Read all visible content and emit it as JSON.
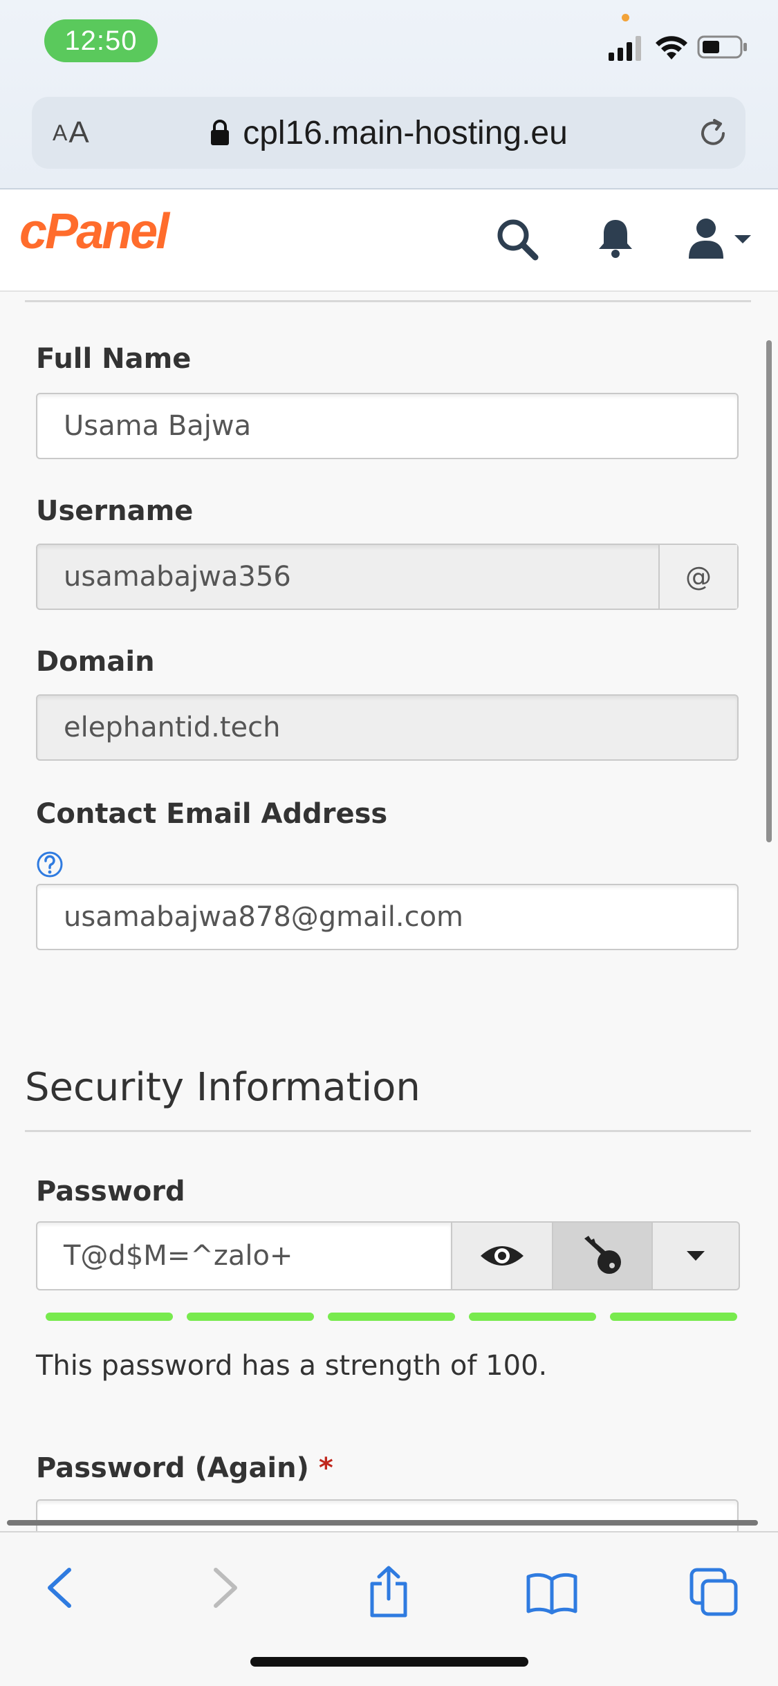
{
  "status_bar": {
    "time": "12:50"
  },
  "browser": {
    "aa_small": "A",
    "aa_large": "A",
    "url": "cpl16.main-hosting.eu"
  },
  "app": {
    "logo": "cPanel"
  },
  "form": {
    "full_name": {
      "label": "Full Name",
      "value": "Usama Bajwa"
    },
    "username": {
      "label": "Username",
      "value": "usamabajwa356",
      "addon": "@"
    },
    "domain": {
      "label": "Domain",
      "value": "elephantid.tech"
    },
    "contact_email": {
      "label": "Contact Email Address",
      "value": "usamabajwa878@gmail.com"
    }
  },
  "security": {
    "title": "Security Information",
    "password": {
      "label": "Password",
      "value": "T@d$M=^zalo+"
    },
    "strength_segments": 5,
    "strength_color": "#78ea4e",
    "strength_text": "This password has a strength of 100.",
    "password_again": {
      "label": "Password (Again)",
      "required_mark": "*"
    }
  },
  "colors": {
    "brand": "#ff6c2c",
    "ios_green": "#5ac95c",
    "ios_blue": "#2f7be0",
    "required": "#c0271d"
  }
}
